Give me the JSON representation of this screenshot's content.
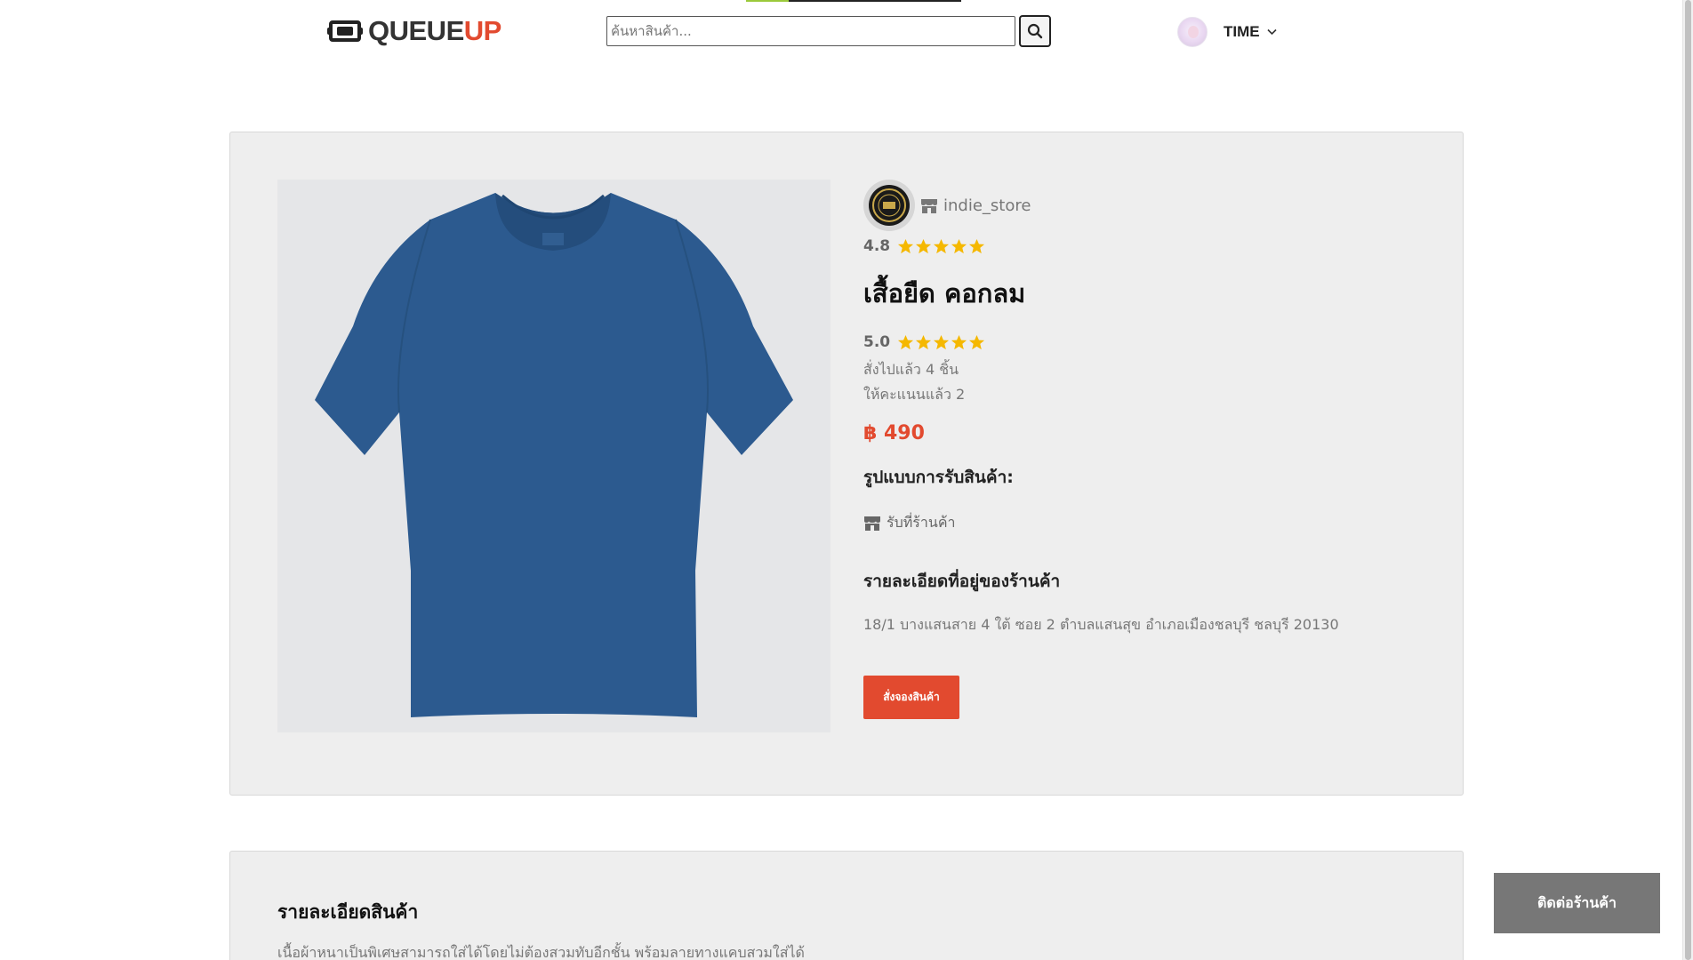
{
  "header": {
    "logo_part1": "QUEUE",
    "logo_part2": "UP",
    "search_placeholder": "ค้นหาสินค้า...",
    "user_name": "TIME"
  },
  "product": {
    "store_name": "indie_store",
    "store_rating": "4.8",
    "title": "เสื้อยืด คอกลม",
    "product_rating": "5.0",
    "ordered_count": "สั่งไปแล้ว 4 ชิ้น",
    "rated_count": "ให้คะแนนแล้ว 2",
    "price": "฿ 490",
    "pickup_heading": "รูปแบบการรับสินค้า:",
    "pickup_option": "รับที่ร้านค้า",
    "address_heading": "รายละเอียดที่อยู่ของร้านค้า",
    "address": "18/1 บางแสนสาย 4 ใต้ ซอย 2 ตำบลแสนสุข อำเภอเมืองชลบุรี ชลบุรี 20130",
    "order_button": "สั่งจองสินค้า"
  },
  "description": {
    "heading": "รายละเอียดสินค้า",
    "text": "เนื้อผ้าหนาเป็นพิเศษสามารถใส่ได้โดยไม่ต้องสวมทับอีกชั้น พร้อมลายทางแคบสวมใส่ได้"
  },
  "contact_button": "ติดต่อร้านค้า",
  "colors": {
    "brand_red": "#e24a2f",
    "star_yellow": "#f5b800",
    "shirt_blue": "#2c5a8f",
    "card_bg": "#eeeeee"
  },
  "icons": {
    "logo": "ticket-icon",
    "search": "search-icon",
    "store": "store-icon",
    "dropdown": "chevron-down-icon",
    "rating": "star-icon"
  }
}
